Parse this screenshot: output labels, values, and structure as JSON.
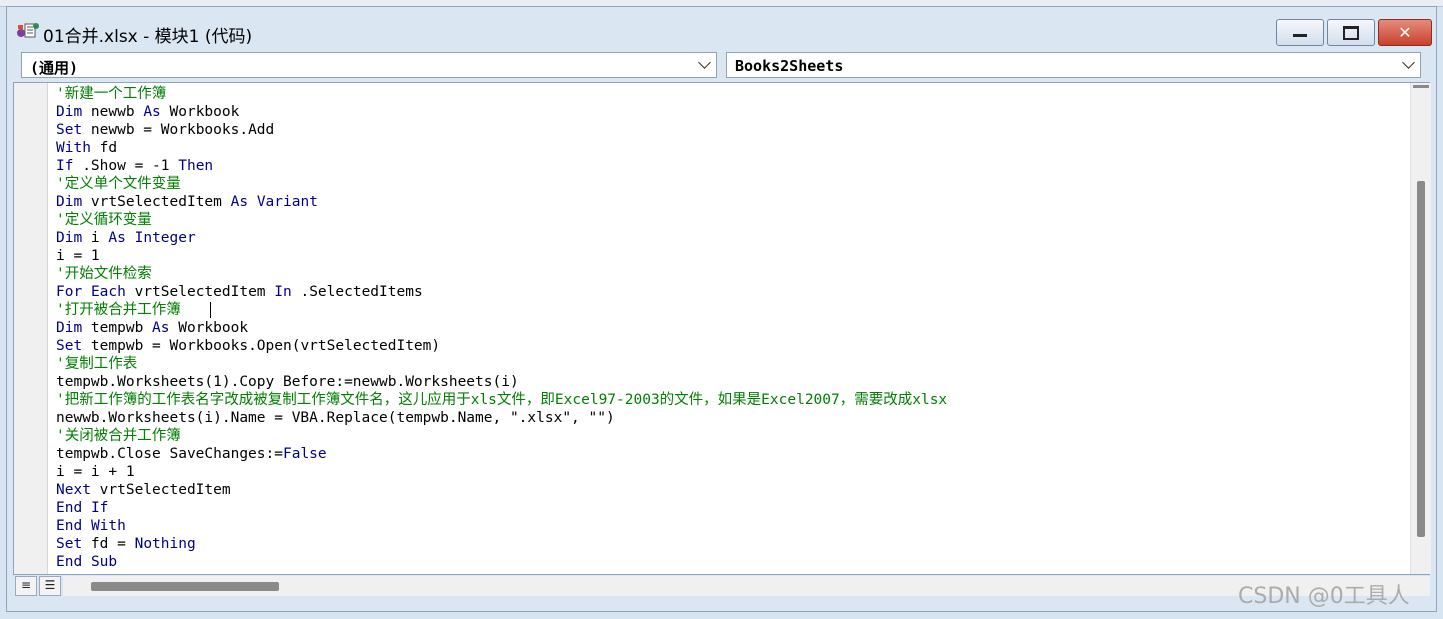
{
  "window": {
    "title": "01合并.xlsx - 模块1 (代码)",
    "minimize_icon": "minimize-icon",
    "maximize_icon": "maximize-icon",
    "close_label": "✕",
    "app_icon": "vbe-module-icon"
  },
  "object_dropdown": {
    "value": "(通用)"
  },
  "procedure_dropdown": {
    "value": "Books2Sheets"
  },
  "colors": {
    "keyword": "#00008b",
    "comment": "#008000",
    "text": "#000000"
  },
  "code": {
    "lines": [
      [
        {
          "t": "'新建一个工作簿",
          "c": "cm"
        }
      ],
      [
        {
          "t": "Dim",
          "c": "kw"
        },
        {
          "t": " newwb "
        },
        {
          "t": "As",
          "c": "kw"
        },
        {
          "t": " Workbook"
        }
      ],
      [
        {
          "t": "Set",
          "c": "kw"
        },
        {
          "t": " newwb = Workbooks.Add"
        }
      ],
      [
        {
          "t": "With",
          "c": "kw"
        },
        {
          "t": " fd"
        }
      ],
      [
        {
          "t": "If",
          "c": "kw"
        },
        {
          "t": " .Show = -1 "
        },
        {
          "t": "Then",
          "c": "kw"
        }
      ],
      [
        {
          "t": "'定义单个文件变量",
          "c": "cm"
        }
      ],
      [
        {
          "t": "Dim",
          "c": "kw"
        },
        {
          "t": " vrtSelectedItem "
        },
        {
          "t": "As",
          "c": "kw"
        },
        {
          "t": " "
        },
        {
          "t": "Variant",
          "c": "kw"
        }
      ],
      [
        {
          "t": "'定义循环变量",
          "c": "cm"
        }
      ],
      [
        {
          "t": "Dim",
          "c": "kw"
        },
        {
          "t": " i "
        },
        {
          "t": "As",
          "c": "kw"
        },
        {
          "t": " "
        },
        {
          "t": "Integer",
          "c": "kw"
        }
      ],
      [
        {
          "t": "i = 1"
        }
      ],
      [
        {
          "t": "'开始文件检索",
          "c": "cm"
        }
      ],
      [
        {
          "t": "For",
          "c": "kw"
        },
        {
          "t": " "
        },
        {
          "t": "Each",
          "c": "kw"
        },
        {
          "t": " vrtSelectedItem "
        },
        {
          "t": "In",
          "c": "kw"
        },
        {
          "t": " .SelectedItems"
        }
      ],
      [
        {
          "t": "'打开被合并工作簿",
          "c": "cm"
        }
      ],
      [
        {
          "t": "Dim",
          "c": "kw"
        },
        {
          "t": " tempwb "
        },
        {
          "t": "As",
          "c": "kw"
        },
        {
          "t": " Workbook"
        }
      ],
      [
        {
          "t": "Set",
          "c": "kw"
        },
        {
          "t": " tempwb = Workbooks.Open(vrtSelectedItem)"
        }
      ],
      [
        {
          "t": "'复制工作表",
          "c": "cm"
        }
      ],
      [
        {
          "t": "tempwb.Worksheets(1).Copy Before:=newwb.Worksheets(i)"
        }
      ],
      [
        {
          "t": "'把新工作簿的工作表名字改成被复制工作簿文件名，这儿应用于xls文件，即Excel97-2003的文件，如果是Excel2007，需要改成xlsx",
          "c": "cm"
        }
      ],
      [
        {
          "t": "newwb.Worksheets(i).Name = VBA.Replace(tempwb.Name, \".xlsx\", \"\")"
        }
      ],
      [
        {
          "t": "'关闭被合并工作簿",
          "c": "cm"
        }
      ],
      [
        {
          "t": "tempwb.Close SaveChanges:="
        },
        {
          "t": "False",
          "c": "kw"
        }
      ],
      [
        {
          "t": "i = i + 1"
        }
      ],
      [
        {
          "t": "Next",
          "c": "kw"
        },
        {
          "t": " vrtSelectedItem"
        }
      ],
      [
        {
          "t": "End",
          "c": "kw"
        },
        {
          "t": " "
        },
        {
          "t": "If",
          "c": "kw"
        }
      ],
      [
        {
          "t": "End",
          "c": "kw"
        },
        {
          "t": " "
        },
        {
          "t": "With",
          "c": "kw"
        }
      ],
      [
        {
          "t": "Set",
          "c": "kw"
        },
        {
          "t": " fd = "
        },
        {
          "t": "Nothing",
          "c": "kw"
        }
      ],
      [
        {
          "t": "End",
          "c": "kw"
        },
        {
          "t": " "
        },
        {
          "t": "Sub",
          "c": "kw"
        }
      ]
    ]
  },
  "footer": {
    "procedure_view_icon": "procedure-view-icon",
    "full_module_view_icon": "full-module-view-icon",
    "procedure_view_glyph": "≡",
    "full_module_view_glyph": "☰"
  },
  "watermark": "CSDN @0工具人"
}
